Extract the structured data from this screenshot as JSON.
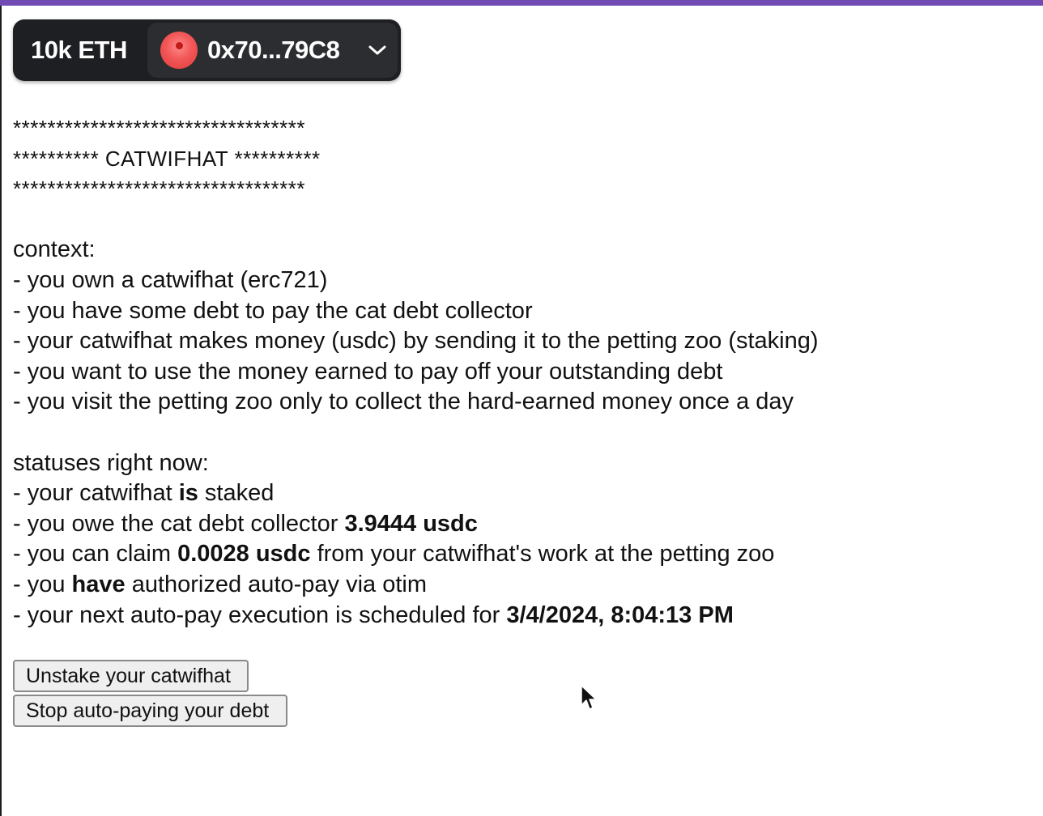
{
  "wallet": {
    "balance": "10k ETH",
    "address": "0x70...79C8",
    "avatar_color": "#f25757",
    "menu_icon": "chevron-down-icon"
  },
  "banner": {
    "line1": "**********************************",
    "line2": "********** CATWIFHAT **********",
    "line3": "**********************************"
  },
  "context": {
    "heading": "context:",
    "items": [
      "- you own a catwifhat (erc721)",
      "- you have some debt to pay the cat debt collector",
      "- your catwifhat makes money (usdc) by sending it to the petting zoo (staking)",
      "- you want to use the money earned to pay off your outstanding debt",
      "- you visit the petting zoo only to collect the hard-earned money once a day"
    ]
  },
  "statuses": {
    "heading": "statuses right now:",
    "staked": {
      "pre": "- your catwifhat ",
      "bold": "is",
      "post": " staked"
    },
    "owe": {
      "pre": "- you owe the cat debt collector ",
      "bold": "3.9444 usdc"
    },
    "claim": {
      "pre": "- you can claim ",
      "bold": "0.0028 usdc",
      "post": " from your catwifhat's work at the petting zoo"
    },
    "autopay": {
      "pre": "- you ",
      "bold": "have",
      "post": " authorized auto-pay via otim"
    },
    "next": {
      "pre": "- your next auto-pay execution is scheduled for ",
      "bold": "3/4/2024, 8:04:13 PM"
    }
  },
  "buttons": {
    "unstake": "Unstake your catwifhat",
    "stop_autopay": "Stop auto-paying your debt"
  },
  "colors": {
    "top_bar": "#6f4bb3",
    "wallet_bg": "#1e1f22",
    "wallet_account_bg": "#2c2d31"
  }
}
